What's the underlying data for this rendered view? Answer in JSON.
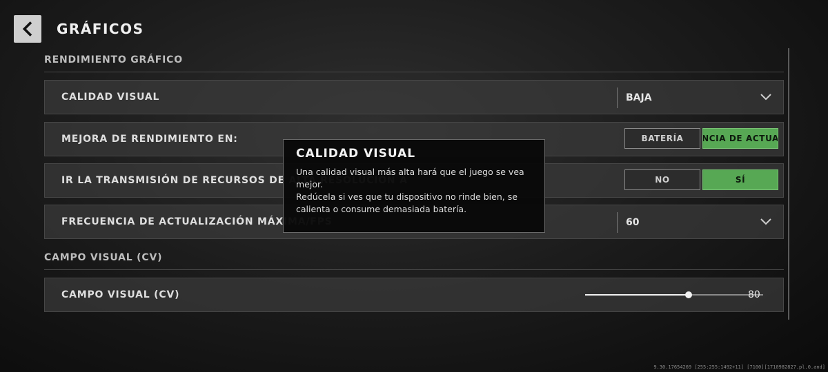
{
  "header": {
    "back_icon": "chevron-left-icon",
    "title": "GRÁFICOS"
  },
  "sections": {
    "rendimiento": "RENDIMIENTO GRÁFICO",
    "campo_visual": "CAMPO VISUAL (CV)"
  },
  "settings": {
    "calidad_visual": {
      "label": "CALIDAD VISUAL",
      "value": "BAJA"
    },
    "mejora_rendimiento": {
      "label": "MEJORA DE RENDIMIENTO EN:",
      "option_off": "BATERÍA",
      "option_on": "NCIA DE ACTUA"
    },
    "transmision": {
      "label": "IR LA TRANSMISIÓN DE RECURSOS DE ALTA RESOLUCIÓN A",
      "option_off": "NO",
      "option_on": "SÍ"
    },
    "frecuencia": {
      "label": "FRECUENCIA DE ACTUALIZACIÓN MÁXIMA/FPS",
      "value": "60"
    },
    "campo_visual": {
      "label": "CAMPO VISUAL (CV)",
      "value": "80",
      "slider_fraction": 0.58
    }
  },
  "tooltip": {
    "title": "CALIDAD VISUAL",
    "line1": "Una calidad visual más alta hará que el juego se vea mejor.",
    "line2": "Redúcela si ves que tu dispositivo no rinde bien, se calienta o consume demasiada batería."
  },
  "build_info": "9.30.17654269 [255:255:1492+11] [7100][1710982827.pl.0.and]",
  "colors": {
    "accent_green": "#57a854",
    "background": "#1d1d1d"
  }
}
